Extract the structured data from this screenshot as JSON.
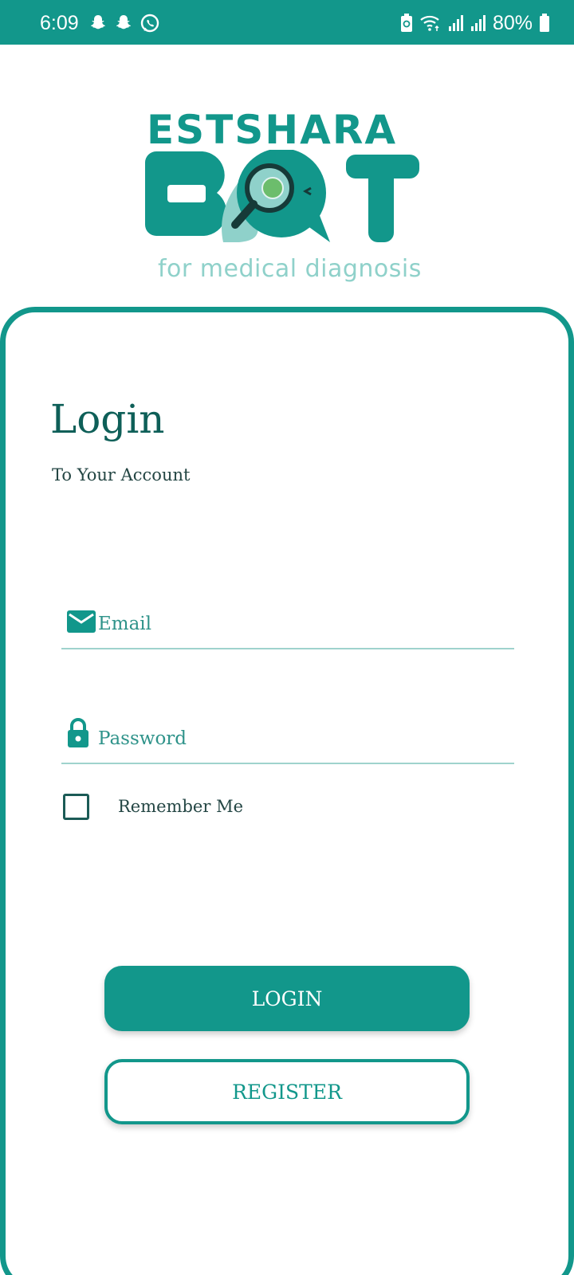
{
  "status_bar": {
    "time": "6:09",
    "battery_percent": "80%",
    "notification_icons": [
      "snapchat-icon",
      "snapchat-icon",
      "whatsapp-icon"
    ],
    "system_icons": [
      "battery-saver-icon",
      "wifi-icon",
      "signal-icon",
      "signal-icon",
      "battery-icon"
    ]
  },
  "logo": {
    "brand_top": "ESTSHARA",
    "brand_main": "BOT",
    "tagline": "for medical diagnosis"
  },
  "login": {
    "title": "Login",
    "subtitle": "To Your Account",
    "email_placeholder": "Email",
    "password_placeholder": "Password",
    "remember_label": "Remember Me",
    "remember_checked": false,
    "login_button": "LOGIN",
    "register_button": "REGISTER"
  },
  "colors": {
    "primary": "#12978b",
    "primary_light": "#8fd1ca",
    "dark_teal": "#0e5f58",
    "text": "#244644"
  }
}
